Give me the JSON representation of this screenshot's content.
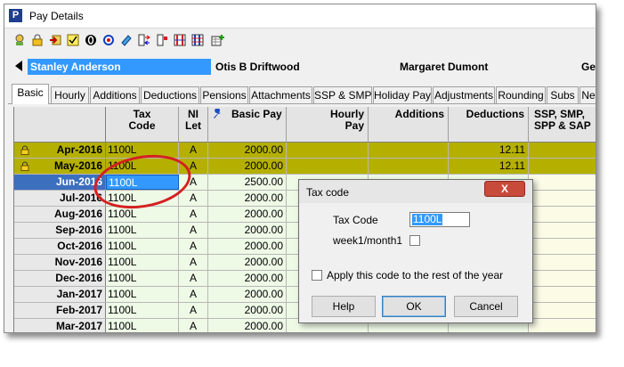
{
  "window": {
    "title": "Pay Details",
    "app_icon_letter": "P"
  },
  "toolbar": {
    "buttons": [
      "wizard-icon",
      "lock-icon",
      "import-icon",
      "checklist-icon",
      "zero-icon",
      "target-icon",
      "note-icon",
      "transfer-icon",
      "flag-icon",
      "grid-compare-icon",
      "grid-edit-icon",
      "add-table-icon"
    ]
  },
  "employee_bar": {
    "selected": "Stanley Anderson",
    "others": [
      "Otis B Driftwood",
      "Margaret Dumont",
      "Ge"
    ]
  },
  "tabs": [
    "Basic",
    "Hourly",
    "Additions",
    "Deductions",
    "Pensions",
    "Attachments",
    "SSP & SMP",
    "Holiday Pay",
    "Adjustments",
    "Rounding",
    "Subs",
    "Ne"
  ],
  "grid": {
    "headers": {
      "tax_code": "Tax\nCode",
      "ni_let": "NI\nLet",
      "basic_pay": "Basic Pay",
      "hourly_pay": "Hourly\nPay",
      "additions": "Additions",
      "deductions": "Deductions",
      "ssp": "SSP, SMP,\nSPP & SAP"
    },
    "rows": [
      {
        "month": "Apr-2016",
        "tax": "1100L",
        "ni": "A",
        "basic": "2000.00",
        "ded": "12.11",
        "state": "locked"
      },
      {
        "month": "May-2016",
        "tax": "1100L",
        "ni": "A",
        "basic": "2000.00",
        "ded": "12.11",
        "state": "locked"
      },
      {
        "month": "Jun-2016",
        "tax": "1100L",
        "ni": "A",
        "basic": "2500.00",
        "ded": "",
        "state": "current"
      },
      {
        "month": "Jul-2016",
        "tax": "1100L",
        "ni": "A",
        "basic": "2000.00",
        "ded": "",
        "state": ""
      },
      {
        "month": "Aug-2016",
        "tax": "1100L",
        "ni": "A",
        "basic": "2000.00",
        "ded": "",
        "state": ""
      },
      {
        "month": "Sep-2016",
        "tax": "1100L",
        "ni": "A",
        "basic": "2000.00",
        "ded": "",
        "state": ""
      },
      {
        "month": "Oct-2016",
        "tax": "1100L",
        "ni": "A",
        "basic": "2000.00",
        "ded": "",
        "state": ""
      },
      {
        "month": "Nov-2016",
        "tax": "1100L",
        "ni": "A",
        "basic": "2000.00",
        "ded": "",
        "state": ""
      },
      {
        "month": "Dec-2016",
        "tax": "1100L",
        "ni": "A",
        "basic": "2000.00",
        "ded": "",
        "state": ""
      },
      {
        "month": "Jan-2017",
        "tax": "1100L",
        "ni": "A",
        "basic": "2000.00",
        "ded": "",
        "state": ""
      },
      {
        "month": "Feb-2017",
        "tax": "1100L",
        "ni": "A",
        "basic": "2000.00",
        "ded": "",
        "state": ""
      },
      {
        "month": "Mar-2017",
        "tax": "1100L",
        "ni": "A",
        "basic": "2000.00",
        "ded": "",
        "state": ""
      }
    ]
  },
  "dialog": {
    "title": "Tax code",
    "tax_code_label": "Tax Code",
    "tax_code_value": "1100L",
    "week1_label": "week1/month1",
    "apply_label": "Apply this code to the rest of the year",
    "help": "Help",
    "ok": "OK",
    "cancel": "Cancel",
    "close_glyph": "X"
  },
  "colors": {
    "locked_row": "#b5b000",
    "selection": "#3399ff",
    "annotation": "#d42020"
  }
}
